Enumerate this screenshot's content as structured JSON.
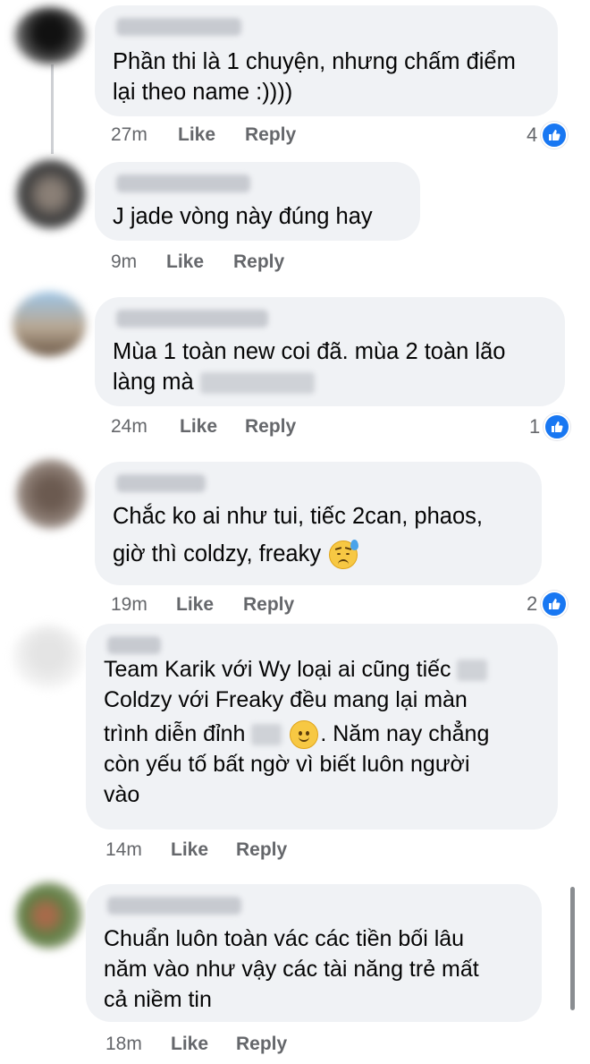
{
  "comments": [
    {
      "text_lines": [
        "Phần thi là 1 chuyện, nhưng chấm điểm",
        "lại theo name :))))"
      ],
      "time": "27m",
      "like_label": "Like",
      "reply_label": "Reply",
      "reaction_count": "4"
    },
    {
      "text_lines": [
        "J jade vòng này đúng hay"
      ],
      "time": "9m",
      "like_label": "Like",
      "reply_label": "Reply",
      "reaction_count": ""
    },
    {
      "text_lines": [
        "Mùa 1 toàn new coi đã. mùa 2 toàn lão",
        "làng mà"
      ],
      "time": "24m",
      "like_label": "Like",
      "reply_label": "Reply",
      "reaction_count": "1"
    },
    {
      "text_lines": [
        "Chắc ko ai như tui, tiếc 2can, phaos,",
        "giờ thì coldzy, freaky"
      ],
      "time": "19m",
      "like_label": "Like",
      "reply_label": "Reply",
      "reaction_count": "2"
    },
    {
      "text_lines": [
        "Team Karik với Wy loại ai cũng tiếc",
        "Coldzy với Freaky đều mang lại màn",
        "trình diễn đỉnh",
        ". Năm nay chẳng",
        "còn yếu tố bất ngờ vì biết luôn người",
        "vào"
      ],
      "time": "14m",
      "like_label": "Like",
      "reply_label": "Reply",
      "reaction_count": ""
    },
    {
      "text_lines": [
        "Chuẩn luôn toàn vác các tiền bối lâu",
        "năm vào như vậy các tài năng trẻ mất",
        "cả niềm tin"
      ],
      "time": "18m",
      "like_label": "Like",
      "reply_label": "Reply",
      "reaction_count": ""
    }
  ],
  "icons": {
    "reaction": "thumbs-up-icon",
    "emoji_sad": "sad-sweat-emoji",
    "emoji_smile": "slight-smile-emoji"
  },
  "colors": {
    "bubble": "#f0f2f5",
    "meta_text": "#65676b",
    "like_blue": "#1877f2"
  }
}
